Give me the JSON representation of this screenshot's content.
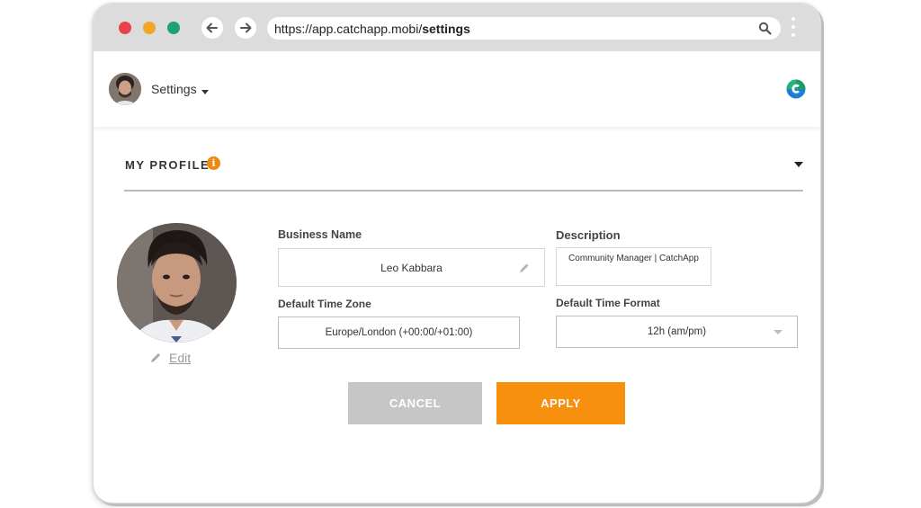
{
  "browser": {
    "url_prefix": "https://app.catchapp.mobi/",
    "url_path": "settings"
  },
  "header": {
    "title": "Settings"
  },
  "profile": {
    "section_title": "MY PROFILE",
    "info_glyph": "i",
    "edit_label": "Edit",
    "business_name_label": "Business Name",
    "business_name_value": "Leo Kabbara",
    "description_label": "Description",
    "description_value": "Community Manager | CatchApp",
    "timezone_label": "Default Time Zone",
    "timezone_value": "Europe/London (+00:00/+01:00)",
    "timeformat_label": "Default Time Format",
    "timeformat_value": "12h (am/pm)"
  },
  "actions": {
    "cancel_label": "CANCEL",
    "apply_label": "APPLY"
  },
  "colors": {
    "accent": "#f7900f",
    "cancel": "#c6c6c6",
    "brand_green": "#1a9e63",
    "brand_blue": "#1e7fd1"
  }
}
